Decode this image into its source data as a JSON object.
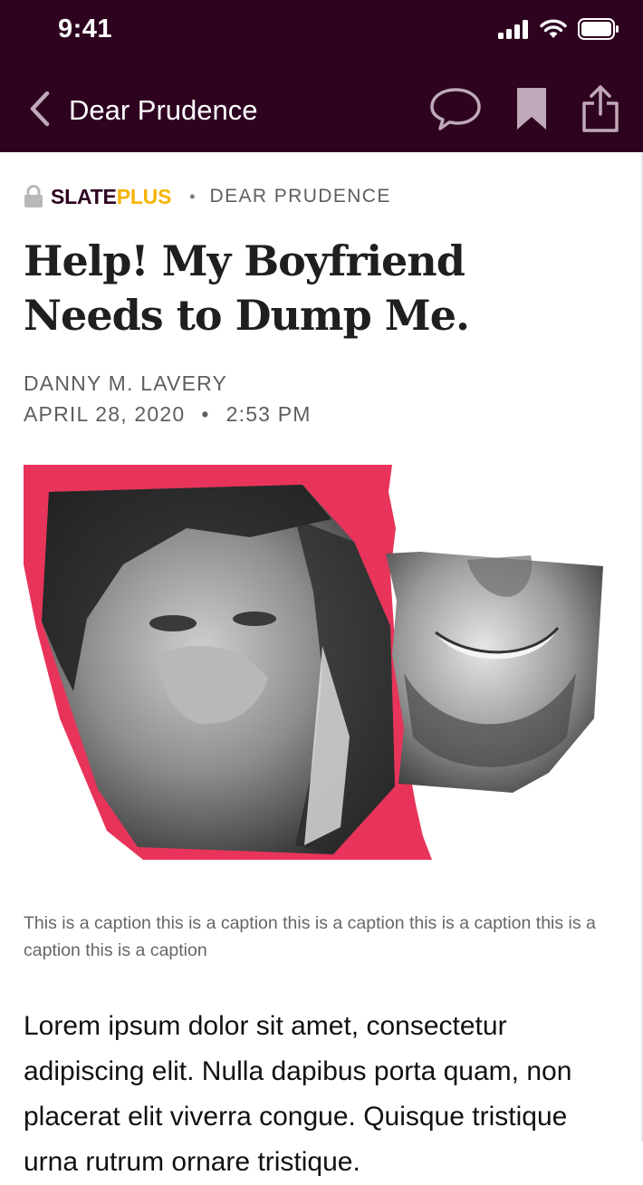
{
  "status_bar": {
    "time": "9:41",
    "icons": [
      "cellular-signal-icon",
      "wifi-icon",
      "battery-icon"
    ]
  },
  "nav": {
    "title": "Dear Prudence",
    "icons": [
      "back-chevron-icon",
      "comment-icon",
      "bookmark-icon",
      "share-icon"
    ]
  },
  "kicker": {
    "brand_part1": "SLATE",
    "brand_part2": "PLUS",
    "separator": "•",
    "section": "DEAR PRUDENCE"
  },
  "article": {
    "headline": "Help! My Boyfriend Needs to Dump Me.",
    "author": "DANNY M. LAVERY",
    "date": "APRIL 28, 2020",
    "date_separator": "•",
    "time": "2:53 PM",
    "caption": "This is a caption this is a caption this is a caption this is a caption this is a caption this is a caption",
    "body": "Lorem ipsum dolor sit amet, consectetur adipiscing elit. Nulla dapibus porta quam, non placerat elit viverra congue. Quisque tristique urna rutrum ornare tristique."
  },
  "colors": {
    "header_bg": "#2e0320",
    "brand_plus": "#f5b400",
    "accent_red": "#e8345a"
  }
}
